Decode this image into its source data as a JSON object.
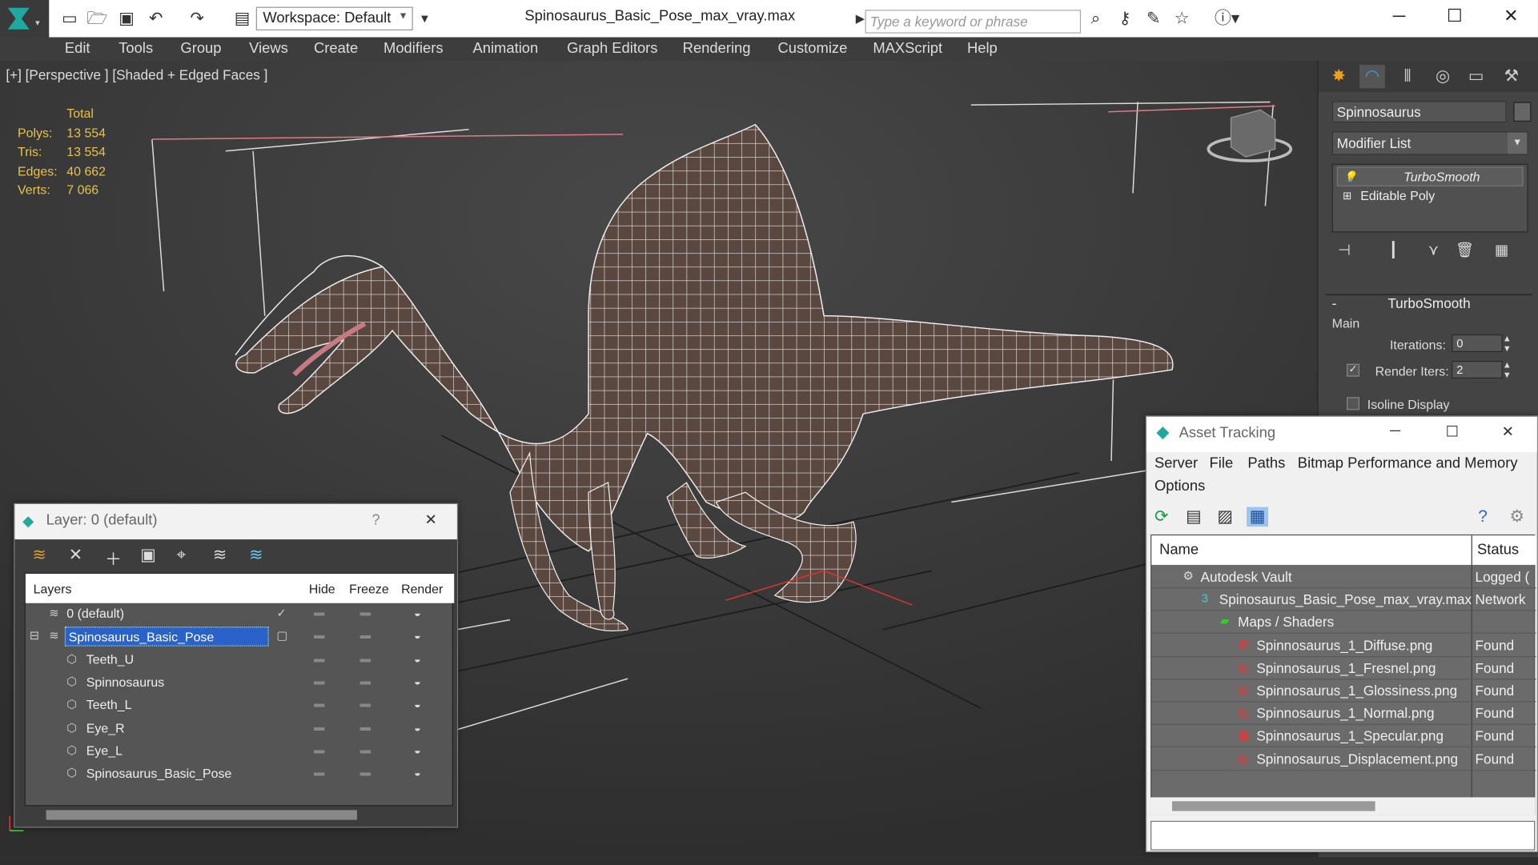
{
  "window": {
    "title": "Spinosaurus_Basic_Pose_max_vray.max",
    "workspace_label": "Workspace: Default",
    "search_placeholder": "Type a keyword or phrase",
    "minimize": "─",
    "maximize": "☐",
    "close": "✕"
  },
  "menu": [
    "Edit",
    "Tools",
    "Group",
    "Views",
    "Create",
    "Modifiers",
    "Animation",
    "Graph Editors",
    "Rendering",
    "Customize",
    "MAXScript",
    "Help"
  ],
  "viewport": {
    "label": "[+] [Perspective ] [Shaded + Edged Faces ]",
    "stats": {
      "header": "Total",
      "rows": [
        {
          "k": "Polys:",
          "v": "13 554"
        },
        {
          "k": "Tris:",
          "v": "13 554"
        },
        {
          "k": "Edges:",
          "v": "40 662"
        },
        {
          "k": "Verts:",
          "v": "7 066"
        }
      ]
    }
  },
  "command_panel": {
    "object_name": "Spinnosaurus",
    "modifier_list": "Modifier List",
    "stack": [
      "TurboSmooth",
      "Editable Poly"
    ],
    "rollout_title": "TurboSmooth",
    "rollout_toggle": "-",
    "group_main": "Main",
    "iterations_label": "Iterations:",
    "iterations_value": "0",
    "render_iters_label": "Render Iters:",
    "render_iters_value": "2",
    "isoline_label": "Isoline Display"
  },
  "layer_dialog": {
    "title": "Layer: 0 (default)",
    "help": "?",
    "close": "✕",
    "headers": {
      "layers": "Layers",
      "hide": "Hide",
      "freeze": "Freeze",
      "render": "Render"
    },
    "rows": [
      {
        "name": "0 (default)",
        "indent": 1,
        "selected": false,
        "current": true
      },
      {
        "name": "Spinosaurus_Basic_Pose",
        "indent": 1,
        "selected": true,
        "current": false
      },
      {
        "name": "Teeth_U",
        "indent": 2,
        "selected": false,
        "current": false
      },
      {
        "name": "Spinnosaurus",
        "indent": 2,
        "selected": false,
        "current": false
      },
      {
        "name": "Teeth_L",
        "indent": 2,
        "selected": false,
        "current": false
      },
      {
        "name": "Eye_R",
        "indent": 2,
        "selected": false,
        "current": false
      },
      {
        "name": "Eye_L",
        "indent": 2,
        "selected": false,
        "current": false
      },
      {
        "name": "Spinosaurus_Basic_Pose",
        "indent": 2,
        "selected": false,
        "current": false
      }
    ]
  },
  "asset_dialog": {
    "title": "Asset Tracking",
    "minimize": "─",
    "maximize": "☐",
    "close": "✕",
    "menu": [
      "Server",
      "File",
      "Paths",
      "Bitmap Performance and Memory",
      "Options"
    ],
    "headers": {
      "name": "Name",
      "status": "Status"
    },
    "rows": [
      {
        "name": "Autodesk Vault",
        "status": "Logged (",
        "indent": 1,
        "icon": "vault-icon"
      },
      {
        "name": "Spinosaurus_Basic_Pose_max_vray.max",
        "status": "Network",
        "indent": 2,
        "icon": "max-file-icon"
      },
      {
        "name": "Maps / Shaders",
        "status": "",
        "indent": 3,
        "icon": "maps-icon"
      },
      {
        "name": "Spinnosaurus_1_Diffuse.png",
        "status": "Found",
        "indent": 4,
        "icon": "png-icon"
      },
      {
        "name": "Spinnosaurus_1_Fresnel.png",
        "status": "Found",
        "indent": 4,
        "icon": "png-icon"
      },
      {
        "name": "Spinnosaurus_1_Glossiness.png",
        "status": "Found",
        "indent": 4,
        "icon": "png-icon"
      },
      {
        "name": "Spinnosaurus_1_Normal.png",
        "status": "Found",
        "indent": 4,
        "icon": "png-icon"
      },
      {
        "name": "Spinnosaurus_1_Specular.png",
        "status": "Found",
        "indent": 4,
        "icon": "png-icon"
      },
      {
        "name": "Spinnosaurus_Displacement.png",
        "status": "Found",
        "indent": 4,
        "icon": "png-icon"
      }
    ]
  },
  "colors": {
    "stats_text": "#e8c24a",
    "selection": "#2a62c9",
    "viewport_bg": "#3c3c3c"
  }
}
